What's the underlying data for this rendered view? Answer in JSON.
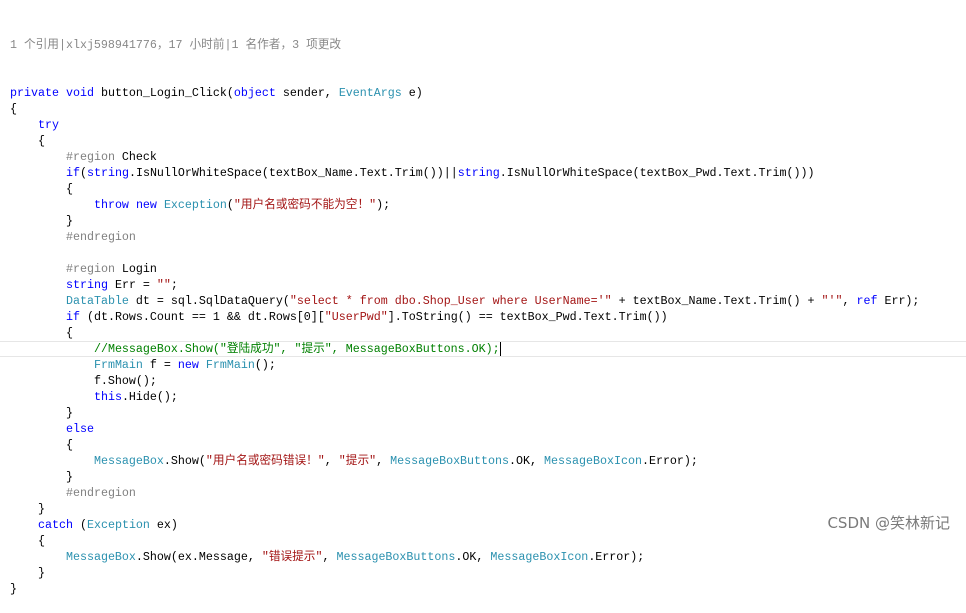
{
  "codelens": "1 个引用|xlxj598941776，17 小时前|1 名作者，3 项更改",
  "current_line": 17,
  "lines": [
    [
      [
        "kw",
        "private"
      ],
      [
        "plain",
        " "
      ],
      [
        "kw",
        "void"
      ],
      [
        "plain",
        " button_Login_Click("
      ],
      [
        "kw",
        "object"
      ],
      [
        "plain",
        " sender, "
      ],
      [
        "type",
        "EventArgs"
      ],
      [
        "plain",
        " e)"
      ]
    ],
    [
      [
        "plain",
        "{"
      ]
    ],
    [
      [
        "plain",
        "    "
      ],
      [
        "kw",
        "try"
      ]
    ],
    [
      [
        "plain",
        "    {"
      ]
    ],
    [
      [
        "plain",
        "        "
      ],
      [
        "pre",
        "#region"
      ],
      [
        "plain",
        " Check"
      ]
    ],
    [
      [
        "plain",
        "        "
      ],
      [
        "kw",
        "if"
      ],
      [
        "plain",
        "("
      ],
      [
        "kw",
        "string"
      ],
      [
        "plain",
        ".IsNullOrWhiteSpace(textBox_Name.Text.Trim())||"
      ],
      [
        "kw",
        "string"
      ],
      [
        "plain",
        ".IsNullOrWhiteSpace(textBox_Pwd.Text.Trim()))"
      ]
    ],
    [
      [
        "plain",
        "        {"
      ]
    ],
    [
      [
        "plain",
        "            "
      ],
      [
        "kw",
        "throw"
      ],
      [
        "plain",
        " "
      ],
      [
        "kw",
        "new"
      ],
      [
        "plain",
        " "
      ],
      [
        "type",
        "Exception"
      ],
      [
        "plain",
        "("
      ],
      [
        "str",
        "\"用户名或密码不能为空！\""
      ],
      [
        "plain",
        ");"
      ]
    ],
    [
      [
        "plain",
        "        }"
      ]
    ],
    [
      [
        "plain",
        "        "
      ],
      [
        "pre",
        "#endregion"
      ]
    ],
    [
      [
        "plain",
        ""
      ]
    ],
    [
      [
        "plain",
        "        "
      ],
      [
        "pre",
        "#region"
      ],
      [
        "plain",
        " Login"
      ]
    ],
    [
      [
        "plain",
        "        "
      ],
      [
        "kw",
        "string"
      ],
      [
        "plain",
        " Err = "
      ],
      [
        "str",
        "\"\""
      ],
      [
        "plain",
        ";"
      ]
    ],
    [
      [
        "plain",
        "        "
      ],
      [
        "type",
        "DataTable"
      ],
      [
        "plain",
        " dt = sql.SqlDataQuery("
      ],
      [
        "str",
        "\"select * from dbo.Shop_User where UserName='\""
      ],
      [
        "plain",
        " + textBox_Name.Text.Trim() + "
      ],
      [
        "str",
        "\"'\""
      ],
      [
        "plain",
        ", "
      ],
      [
        "kw",
        "ref"
      ],
      [
        "plain",
        " Err);"
      ]
    ],
    [
      [
        "plain",
        "        "
      ],
      [
        "kw",
        "if"
      ],
      [
        "plain",
        " (dt.Rows.Count == 1 && dt.Rows[0]["
      ],
      [
        "str",
        "\"UserPwd\""
      ],
      [
        "plain",
        "].ToString() == textBox_Pwd.Text.Trim())"
      ]
    ],
    [
      [
        "plain",
        "        {"
      ]
    ],
    [
      [
        "plain",
        "            "
      ],
      [
        "cmt",
        "//MessageBox.Show(\"登陆成功\", \"提示\", MessageBoxButtons.OK);"
      ]
    ],
    [
      [
        "plain",
        "            "
      ],
      [
        "type",
        "FrmMain"
      ],
      [
        "plain",
        " f = "
      ],
      [
        "kw",
        "new"
      ],
      [
        "plain",
        " "
      ],
      [
        "type",
        "FrmMain"
      ],
      [
        "plain",
        "();"
      ]
    ],
    [
      [
        "plain",
        "            f.Show();"
      ]
    ],
    [
      [
        "plain",
        "            "
      ],
      [
        "kw",
        "this"
      ],
      [
        "plain",
        ".Hide();"
      ]
    ],
    [
      [
        "plain",
        "        }"
      ]
    ],
    [
      [
        "plain",
        "        "
      ],
      [
        "kw",
        "else"
      ]
    ],
    [
      [
        "plain",
        "        {"
      ]
    ],
    [
      [
        "plain",
        "            "
      ],
      [
        "type",
        "MessageBox"
      ],
      [
        "plain",
        ".Show("
      ],
      [
        "str",
        "\"用户名或密码错误！\""
      ],
      [
        "plain",
        ", "
      ],
      [
        "str",
        "\"提示\""
      ],
      [
        "plain",
        ", "
      ],
      [
        "type",
        "MessageBoxButtons"
      ],
      [
        "plain",
        ".OK, "
      ],
      [
        "type",
        "MessageBoxIcon"
      ],
      [
        "plain",
        ".Error);"
      ]
    ],
    [
      [
        "plain",
        "        }"
      ]
    ],
    [
      [
        "plain",
        "        "
      ],
      [
        "pre",
        "#endregion"
      ]
    ],
    [
      [
        "plain",
        "    }"
      ]
    ],
    [
      [
        "plain",
        "    "
      ],
      [
        "kw",
        "catch"
      ],
      [
        "plain",
        " ("
      ],
      [
        "type",
        "Exception"
      ],
      [
        "plain",
        " ex)"
      ]
    ],
    [
      [
        "plain",
        "    {"
      ]
    ],
    [
      [
        "plain",
        "        "
      ],
      [
        "type",
        "MessageBox"
      ],
      [
        "plain",
        ".Show(ex.Message, "
      ],
      [
        "str",
        "\"错误提示\""
      ],
      [
        "plain",
        ", "
      ],
      [
        "type",
        "MessageBoxButtons"
      ],
      [
        "plain",
        ".OK, "
      ],
      [
        "type",
        "MessageBoxIcon"
      ],
      [
        "plain",
        ".Error);"
      ]
    ],
    [
      [
        "plain",
        "    }"
      ]
    ],
    [
      [
        "plain",
        "}"
      ]
    ]
  ],
  "watermark": "CSDN @笑林新记"
}
